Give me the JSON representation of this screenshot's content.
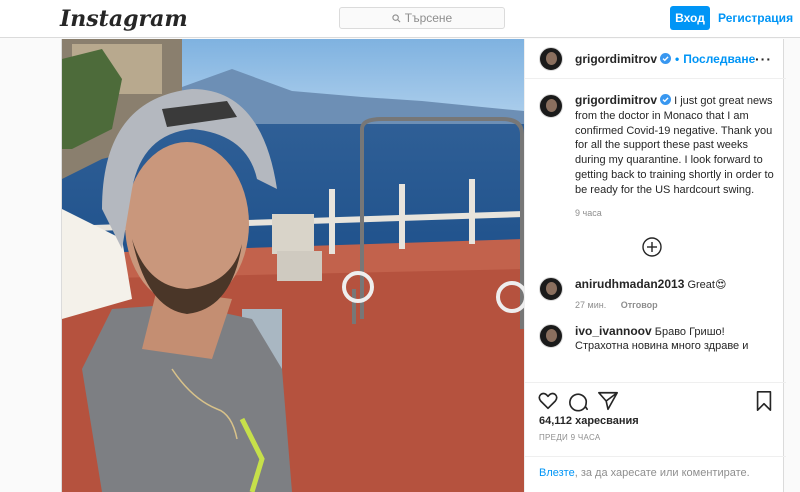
{
  "brand": {
    "logo_text": "Instagram"
  },
  "search": {
    "placeholder": "Търсене"
  },
  "auth": {
    "login_label": "Вход",
    "signup_label": "Регистрация"
  },
  "post": {
    "username": "grigordimitrov",
    "follow_label": "Последване",
    "caption": "I just got great news from the doctor in Monaco that I am confirmed Covid-19 negative. Thank you for all the support these past weeks during my quarantine. I look forward to getting back to training shortly in order to be ready for the US hardcourt swing.",
    "caption_time": "9 часа",
    "comments": [
      {
        "username": "anirudhmadan2013",
        "text": "Great😍",
        "time": "27 мин.",
        "reply_label": "Отговор"
      },
      {
        "username": "ivo_ivannoov",
        "text": "Браво Гришо!",
        "text2": "Страхотна новина много здраве и",
        "time": "",
        "reply_label": ""
      }
    ],
    "likes": "64,112 харесвания",
    "posted_ago": "ПРЕДИ 9 ЧАСА",
    "login_prompt_link": "Влезте",
    "login_prompt_rest": ", за да харесате или коментирате."
  },
  "icons": [
    "search-icon",
    "verified-icon",
    "more-icon",
    "plus-circle-icon",
    "heart-icon",
    "comment-icon",
    "share-icon",
    "bookmark-icon"
  ],
  "colors": {
    "accent": "#0095f6",
    "border": "#dbdbdb",
    "muted": "#8e8e8e",
    "text": "#262626"
  }
}
